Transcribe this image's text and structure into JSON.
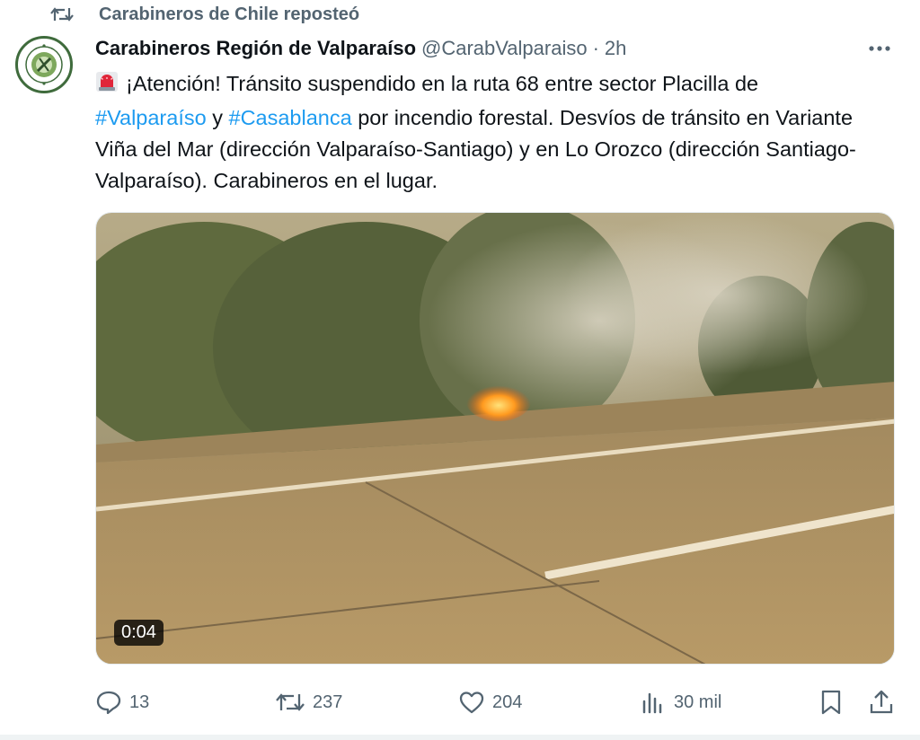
{
  "repost": {
    "text": "Carabineros de Chile reposteó",
    "icon": "repost-icon"
  },
  "author": {
    "display_name": "Carabineros Región de Valparaíso",
    "handle": "@CarabValparaiso",
    "separator": "·",
    "time": "2h"
  },
  "tweet": {
    "emoji": "rotating-light-emoji",
    "line1": "¡Atención! Tránsito suspendido en la ruta 68 entre sector Placilla de",
    "hashtag1": "#Valparaíso",
    "conj": " y ",
    "hashtag2": "#Casablanca",
    "rest": " por incendio forestal. Desvíos de tránsito en Variante Viña del Mar (dirección Valparaíso-Santiago) y en Lo Orozco (dirección Santiago-Valparaíso). Carabineros en el lugar."
  },
  "media": {
    "type": "video",
    "duration": "0:04"
  },
  "actions": {
    "replies": "13",
    "reposts": "237",
    "likes": "204",
    "views": "30 mil"
  },
  "colors": {
    "accent": "#1d9bf0",
    "secondary_text": "#536471"
  }
}
